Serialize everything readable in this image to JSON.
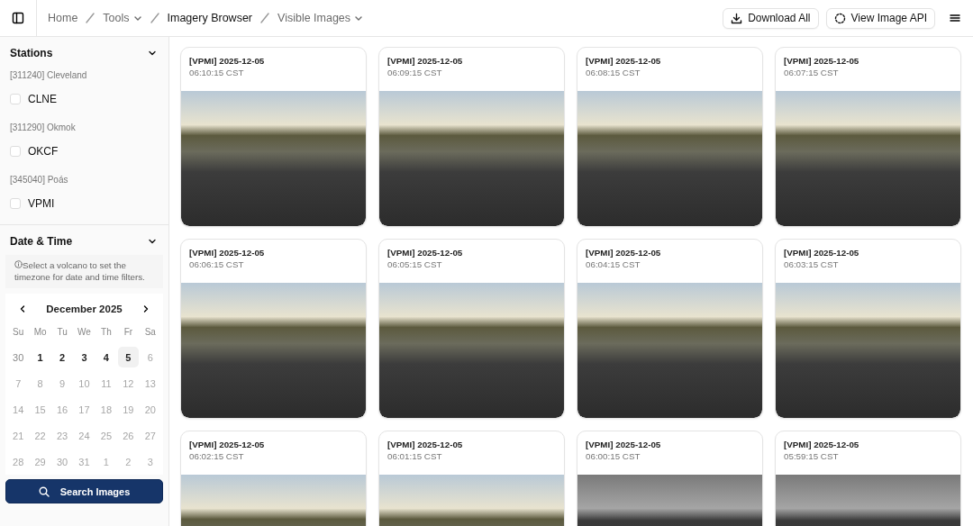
{
  "breadcrumbs": [
    {
      "label": "Home",
      "dropdown": false,
      "current": false
    },
    {
      "label": "Tools",
      "dropdown": true,
      "current": false
    },
    {
      "label": "Imagery Browser",
      "dropdown": false,
      "current": true
    },
    {
      "label": "Visible Images",
      "dropdown": true,
      "current": false
    }
  ],
  "actions": [
    {
      "label": "Download All",
      "kind": "download"
    },
    {
      "label": "View Image API",
      "kind": "api"
    }
  ],
  "stations": {
    "title": "Stations",
    "expanded": true,
    "groups": [
      {
        "label": "[311240] Cleveland",
        "items": [
          {
            "label": "CLNE",
            "checked": false
          }
        ]
      },
      {
        "label": "[311290] Okmok",
        "items": [
          {
            "label": "OKCF",
            "checked": false
          }
        ]
      },
      {
        "label": "[345040] Poás",
        "items": [
          {
            "label": "VPMI",
            "checked": false
          }
        ]
      }
    ]
  },
  "date_time": {
    "title": "Date & Time",
    "expanded": true,
    "note": "Select a volcano to set the timezone for date and time filters.",
    "calendar": {
      "month": "December 2025",
      "weekdays": [
        "Su",
        "Mo",
        "Tu",
        "We",
        "Th",
        "Fr",
        "Sa"
      ],
      "weeks": [
        [
          {
            "label": "30",
            "outside": true,
            "disabled": false,
            "selected": false
          },
          {
            "label": "1",
            "outside": false,
            "disabled": false,
            "selected": false
          },
          {
            "label": "2",
            "outside": false,
            "disabled": false,
            "selected": false
          },
          {
            "label": "3",
            "outside": false,
            "disabled": false,
            "selected": false
          },
          {
            "label": "4",
            "outside": false,
            "disabled": false,
            "selected": false
          },
          {
            "label": "5",
            "outside": false,
            "disabled": false,
            "selected": true
          },
          {
            "label": "6",
            "outside": false,
            "disabled": true,
            "selected": false
          }
        ],
        [
          {
            "label": "7",
            "outside": false,
            "disabled": true,
            "selected": false
          },
          {
            "label": "8",
            "outside": false,
            "disabled": true,
            "selected": false
          },
          {
            "label": "9",
            "outside": false,
            "disabled": true,
            "selected": false
          },
          {
            "label": "10",
            "outside": false,
            "disabled": true,
            "selected": false
          },
          {
            "label": "11",
            "outside": false,
            "disabled": true,
            "selected": false
          },
          {
            "label": "12",
            "outside": false,
            "disabled": true,
            "selected": false
          },
          {
            "label": "13",
            "outside": false,
            "disabled": true,
            "selected": false
          }
        ],
        [
          {
            "label": "14",
            "outside": false,
            "disabled": true,
            "selected": false
          },
          {
            "label": "15",
            "outside": false,
            "disabled": true,
            "selected": false
          },
          {
            "label": "16",
            "outside": false,
            "disabled": true,
            "selected": false
          },
          {
            "label": "17",
            "outside": false,
            "disabled": true,
            "selected": false
          },
          {
            "label": "18",
            "outside": false,
            "disabled": true,
            "selected": false
          },
          {
            "label": "19",
            "outside": false,
            "disabled": true,
            "selected": false
          },
          {
            "label": "20",
            "outside": false,
            "disabled": true,
            "selected": false
          }
        ],
        [
          {
            "label": "21",
            "outside": false,
            "disabled": true,
            "selected": false
          },
          {
            "label": "22",
            "outside": false,
            "disabled": true,
            "selected": false
          },
          {
            "label": "23",
            "outside": false,
            "disabled": true,
            "selected": false
          },
          {
            "label": "24",
            "outside": false,
            "disabled": true,
            "selected": false
          },
          {
            "label": "25",
            "outside": false,
            "disabled": true,
            "selected": false
          },
          {
            "label": "26",
            "outside": false,
            "disabled": true,
            "selected": false
          },
          {
            "label": "27",
            "outside": false,
            "disabled": true,
            "selected": false
          }
        ],
        [
          {
            "label": "28",
            "outside": false,
            "disabled": true,
            "selected": false
          },
          {
            "label": "29",
            "outside": false,
            "disabled": true,
            "selected": false
          },
          {
            "label": "30",
            "outside": false,
            "disabled": true,
            "selected": false
          },
          {
            "label": "31",
            "outside": false,
            "disabled": true,
            "selected": false
          },
          {
            "label": "1",
            "outside": true,
            "disabled": true,
            "selected": false
          },
          {
            "label": "2",
            "outside": true,
            "disabled": true,
            "selected": false
          },
          {
            "label": "3",
            "outside": true,
            "disabled": true,
            "selected": false
          }
        ]
      ]
    }
  },
  "search_button": "Search Images",
  "images": [
    {
      "title": "[VPMI] 2025-12-05",
      "time": "06:10:15 CST",
      "kind": "color"
    },
    {
      "title": "[VPMI] 2025-12-05",
      "time": "06:09:15 CST",
      "kind": "color"
    },
    {
      "title": "[VPMI] 2025-12-05",
      "time": "06:08:15 CST",
      "kind": "color"
    },
    {
      "title": "[VPMI] 2025-12-05",
      "time": "06:07:15 CST",
      "kind": "color"
    },
    {
      "title": "[VPMI] 2025-12-05",
      "time": "06:06:15 CST",
      "kind": "color"
    },
    {
      "title": "[VPMI] 2025-12-05",
      "time": "06:05:15 CST",
      "kind": "color"
    },
    {
      "title": "[VPMI] 2025-12-05",
      "time": "06:04:15 CST",
      "kind": "color"
    },
    {
      "title": "[VPMI] 2025-12-05",
      "time": "06:03:15 CST",
      "kind": "color"
    },
    {
      "title": "[VPMI] 2025-12-05",
      "time": "06:02:15 CST",
      "kind": "color"
    },
    {
      "title": "[VPMI] 2025-12-05",
      "time": "06:01:15 CST",
      "kind": "color"
    },
    {
      "title": "[VPMI] 2025-12-05",
      "time": "06:00:15 CST",
      "kind": "grayscale"
    },
    {
      "title": "[VPMI] 2025-12-05",
      "time": "05:59:15 CST",
      "kind": "grayscale"
    }
  ]
}
